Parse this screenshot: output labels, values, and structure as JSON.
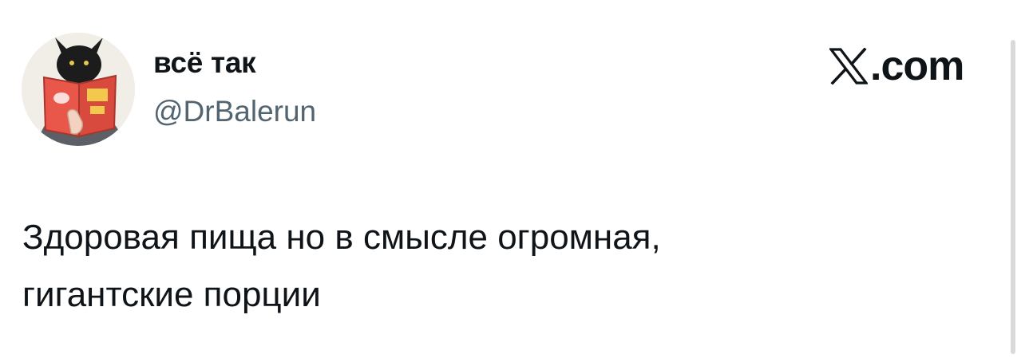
{
  "tweet": {
    "author": {
      "display_name": "всё так",
      "handle": "@DrBalerun",
      "avatar": "avatar-devil-reading-book"
    },
    "brand": {
      "icon": "x-logo-icon",
      "suffix": ".com"
    },
    "text_lines": [
      "Здоровая пища но в смысле огромная,",
      "гигантские порции"
    ]
  },
  "colors": {
    "text_primary": "#0f1419",
    "text_secondary": "#536471",
    "background": "#ffffff",
    "book_red": "#e8574a"
  }
}
